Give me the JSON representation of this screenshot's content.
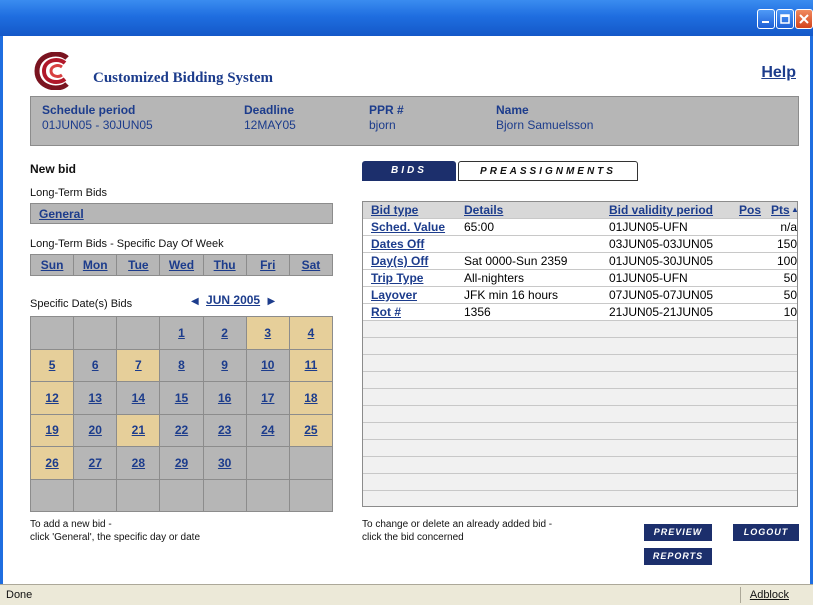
{
  "window": {
    "buttons": [
      "minimize-icon",
      "maximize-icon",
      "close-icon"
    ]
  },
  "header": {
    "title": "Customized Bidding System",
    "help": "Help"
  },
  "info": {
    "schedule_label": "Schedule period",
    "schedule_value": "01JUN05 - 30JUN05",
    "deadline_label": "Deadline",
    "deadline_value": "12MAY05",
    "ppr_label": "PPR #",
    "ppr_value": "bjorn",
    "name_label": "Name",
    "name_value": "Bjorn Samuelsson"
  },
  "left": {
    "new_bid": "New bid",
    "long_term": "Long-Term Bids",
    "general": "General",
    "dow_title": "Long-Term Bids - Specific Day Of Week",
    "days": [
      "Sun",
      "Mon",
      "Tue",
      "Wed",
      "Thu",
      "Fri",
      "Sat"
    ],
    "dates_title": "Specific Date(s) Bids",
    "month": "JUN",
    "year": "2005",
    "calendar": [
      [
        {
          "d": "",
          "hl": false
        },
        {
          "d": "",
          "hl": false
        },
        {
          "d": "",
          "hl": false
        },
        {
          "d": "1",
          "hl": false
        },
        {
          "d": "2",
          "hl": false
        },
        {
          "d": "3",
          "hl": true
        },
        {
          "d": "4",
          "hl": true
        }
      ],
      [
        {
          "d": "5",
          "hl": true
        },
        {
          "d": "6",
          "hl": false
        },
        {
          "d": "7",
          "hl": true
        },
        {
          "d": "8",
          "hl": false
        },
        {
          "d": "9",
          "hl": false
        },
        {
          "d": "10",
          "hl": false
        },
        {
          "d": "11",
          "hl": true
        }
      ],
      [
        {
          "d": "12",
          "hl": true
        },
        {
          "d": "13",
          "hl": false
        },
        {
          "d": "14",
          "hl": false
        },
        {
          "d": "15",
          "hl": false
        },
        {
          "d": "16",
          "hl": false
        },
        {
          "d": "17",
          "hl": false
        },
        {
          "d": "18",
          "hl": true
        }
      ],
      [
        {
          "d": "19",
          "hl": true
        },
        {
          "d": "20",
          "hl": false
        },
        {
          "d": "21",
          "hl": true
        },
        {
          "d": "22",
          "hl": false
        },
        {
          "d": "23",
          "hl": false
        },
        {
          "d": "24",
          "hl": false
        },
        {
          "d": "25",
          "hl": true
        }
      ],
      [
        {
          "d": "26",
          "hl": true
        },
        {
          "d": "27",
          "hl": false
        },
        {
          "d": "28",
          "hl": false
        },
        {
          "d": "29",
          "hl": false
        },
        {
          "d": "30",
          "hl": false
        },
        {
          "d": "",
          "hl": false
        },
        {
          "d": "",
          "hl": false
        }
      ],
      [
        {
          "d": "",
          "hl": false
        },
        {
          "d": "",
          "hl": false
        },
        {
          "d": "",
          "hl": false
        },
        {
          "d": "",
          "hl": false
        },
        {
          "d": "",
          "hl": false
        },
        {
          "d": "",
          "hl": false
        },
        {
          "d": "",
          "hl": false
        }
      ]
    ],
    "hint_line1": "To add a new bid -",
    "hint_line2": "click 'General', the specific day or date"
  },
  "tabs": {
    "bids": "BIDS",
    "preassignments": "PREASSIGNMENTS"
  },
  "table": {
    "columns": [
      "Bid type",
      "Details",
      "Bid validity period",
      "Pos",
      "Pts"
    ],
    "sort_icon": "sort-up-icon",
    "rows": [
      {
        "type": "Sched. Value",
        "details": "65:00",
        "period": "01JUN05-UFN",
        "pos": "",
        "pts": "n/a"
      },
      {
        "type": "Dates Off",
        "details": "",
        "period": "03JUN05-03JUN05",
        "pos": "",
        "pts": "150"
      },
      {
        "type": "Day(s) Off",
        "details": "Sat 0000-Sun 2359",
        "period": "01JUN05-30JUN05",
        "pos": "",
        "pts": "100"
      },
      {
        "type": "Trip Type",
        "details": "All-nighters",
        "period": "01JUN05-UFN",
        "pos": "",
        "pts": "50"
      },
      {
        "type": "Layover",
        "details": "JFK min 16 hours",
        "period": "07JUN05-07JUN05",
        "pos": "",
        "pts": "50"
      },
      {
        "type": "Rot #",
        "details": "1356",
        "period": "21JUN05-21JUN05",
        "pos": "",
        "pts": "10"
      }
    ],
    "hint_line1": "To change or delete an already added bid -",
    "hint_line2": "click the bid concerned"
  },
  "buttons": {
    "preview": "PREVIEW",
    "logout": "LOGOUT",
    "reports": "REPORTS"
  },
  "status": {
    "text": "Done",
    "adblock": "Adblock"
  },
  "colors": {
    "accent": "#1c3c8c",
    "panel": "#b6b6b6",
    "highlight": "#e6cf9a",
    "button": "#1c2f6c",
    "titlebar": "#1f6ee0"
  }
}
